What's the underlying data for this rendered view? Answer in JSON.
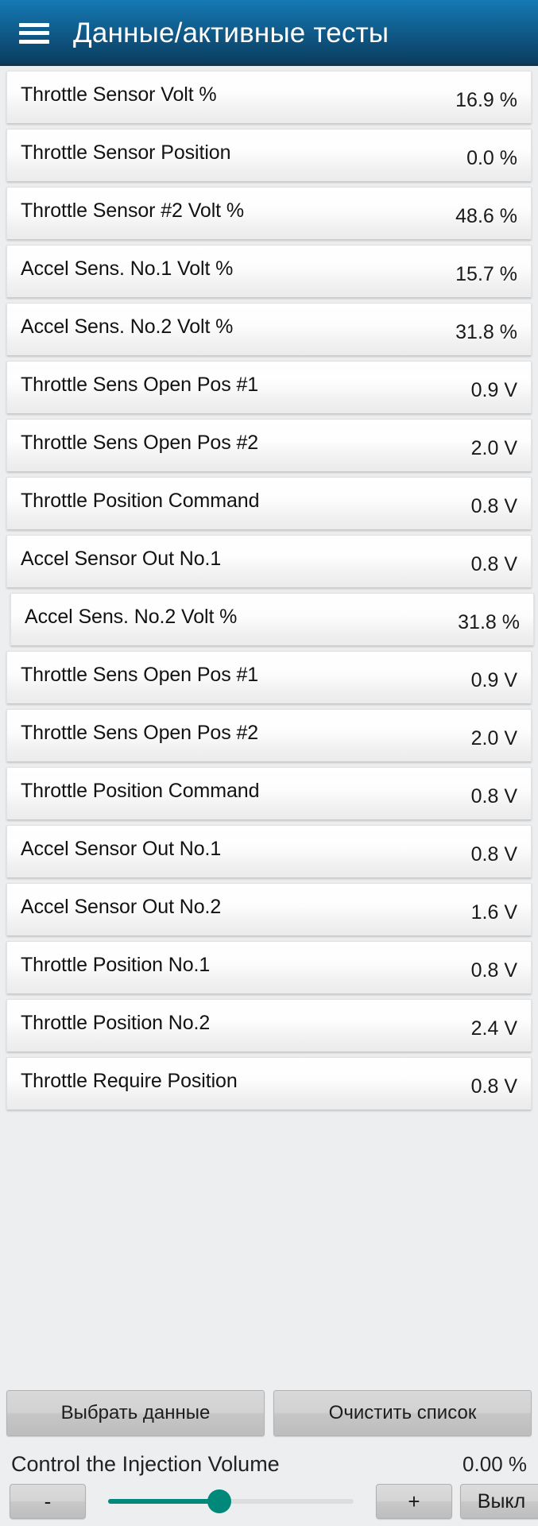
{
  "header": {
    "menu_icon": "hamburger-menu-icon",
    "title": "Данные/активные тесты",
    "gradient_top": "#1579b5",
    "gradient_bottom": "#0a3b5c"
  },
  "list": {
    "rows": [
      {
        "label": "Throttle Sensor Volt %",
        "value": "16.9 %",
        "shifted": false
      },
      {
        "label": "Throttle Sensor Position",
        "value": "0.0 %",
        "shifted": false
      },
      {
        "label": "Throttle Sensor #2 Volt %",
        "value": "48.6 %",
        "shifted": false
      },
      {
        "label": "Accel Sens. No.1 Volt %",
        "value": "15.7 %",
        "shifted": false
      },
      {
        "label": "Accel Sens. No.2 Volt %",
        "value": "31.8 %",
        "shifted": false
      },
      {
        "label": "Throttle Sens Open Pos #1",
        "value": "0.9 V",
        "shifted": false
      },
      {
        "label": "Throttle Sens Open Pos #2",
        "value": "2.0 V",
        "shifted": false
      },
      {
        "label": "Throttle Position Command",
        "value": "0.8 V",
        "shifted": false
      },
      {
        "label": "Accel Sensor Out No.1",
        "value": "0.8 V",
        "shifted": false
      },
      {
        "label": "Accel Sens. No.2 Volt %",
        "value": "31.8 %",
        "shifted": true
      },
      {
        "label": "Throttle Sens Open Pos #1",
        "value": "0.9 V",
        "shifted": false
      },
      {
        "label": "Throttle Sens Open Pos #2",
        "value": "2.0 V",
        "shifted": false
      },
      {
        "label": "Throttle Position Command",
        "value": "0.8 V",
        "shifted": false
      },
      {
        "label": "Accel Sensor Out No.1",
        "value": "0.8 V",
        "shifted": false
      },
      {
        "label": "Accel Sensor Out No.2",
        "value": "1.6 V",
        "shifted": false
      },
      {
        "label": "Throttle Position No.1",
        "value": "0.8 V",
        "shifted": false
      },
      {
        "label": "Throttle Position No.2",
        "value": "2.4 V",
        "shifted": false
      },
      {
        "label": "Throttle Require Position",
        "value": "0.8 V",
        "shifted": false
      }
    ]
  },
  "actions": {
    "select_data_label": "Выбрать данные",
    "clear_list_label": "Очистить список"
  },
  "injection": {
    "label": "Control the Injection Volume",
    "value": "0.00 %",
    "slider_percent": 42,
    "slider_accent": "#00897b",
    "slider_track_color": "#dddddd",
    "minus_label": "-",
    "plus_label": "+",
    "off_label": "Выкл"
  }
}
